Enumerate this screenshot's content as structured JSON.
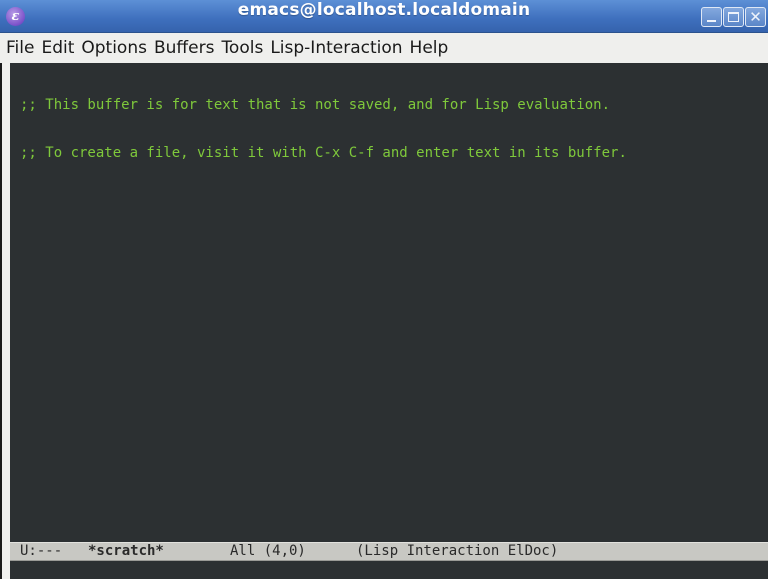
{
  "window": {
    "title": "emacs@localhost.localdomain",
    "app_icon_glyph": "ε",
    "app_icon_name": "emacs-icon",
    "buttons": {
      "minimize": "minimize",
      "maximize": "maximize",
      "close_glyph": "✕"
    }
  },
  "menubar": {
    "items": [
      {
        "label": "File"
      },
      {
        "label": "Edit"
      },
      {
        "label": "Options"
      },
      {
        "label": "Buffers"
      },
      {
        "label": "Tools"
      },
      {
        "label": "Lisp-Interaction"
      },
      {
        "label": "Help"
      }
    ]
  },
  "buffer": {
    "lines": [
      ";; This buffer is for text that is not saved, and for Lisp evaluation.",
      ";; To create a file, visit it with C-x C-f and enter text in its buffer."
    ]
  },
  "modeline": {
    "state": "U:---",
    "buffer_name": "*scratch*",
    "position": "All (4,0)",
    "modes": "(Lisp Interaction ElDoc)"
  },
  "colors": {
    "titlebar": "#3e6fbd",
    "editor_background": "#2c3032",
    "comment_text": "#7fc93b",
    "modeline_background": "#c8c8c3"
  }
}
